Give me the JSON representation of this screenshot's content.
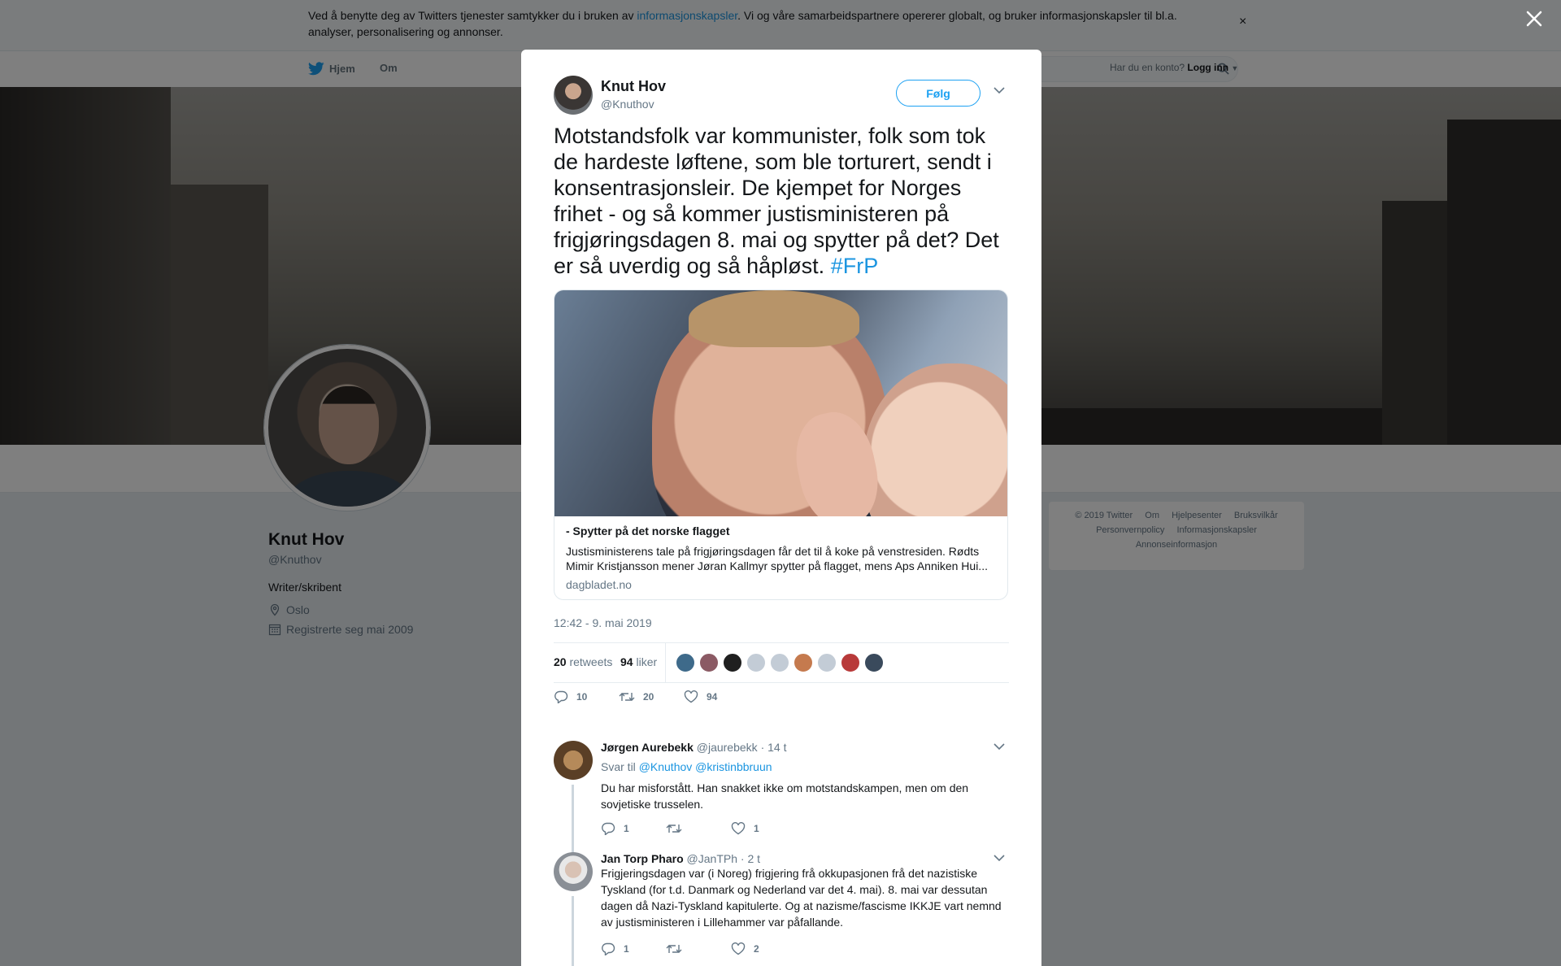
{
  "cookie": {
    "text_before": "Ved å benytte deg av Twitters tjenester samtykker du i bruken av ",
    "link": "informasjonskapsler",
    "text_after": ". Vi og våre samarbeidspartnere opererer globalt, og bruker informasjonskapsler til bl.a. analyser, personalisering og annonser.",
    "close": "×"
  },
  "nav": {
    "home": "Hjem",
    "about": "Om",
    "login_prompt": "Har du en konto?",
    "login": "Logg inn"
  },
  "profile": {
    "name": "Knut Hov",
    "handle": "@Knuthov",
    "bio": "Writer/skribent",
    "location": "Oslo",
    "joined": "Registrerte seg mai 2009"
  },
  "footer": {
    "row1": [
      "© 2019 Twitter",
      "Om",
      "Hjelpesenter",
      "Bruksvilkår"
    ],
    "row2": [
      "Personvernpolicy",
      "Informasjonskapsler"
    ],
    "row3": [
      "Annonseinformasjon"
    ]
  },
  "tweet": {
    "author_name": "Knut Hov",
    "author_handle": "@Knuthov",
    "follow": "Følg",
    "text": "Motstandsfolk var kommunister, folk som tok de hardeste løftene, som ble torturert, sendt i konsentrasjonsleir. De kjempet for Norges frihet - og så kommer justisministeren på frigjøringsdagen 8. mai og spytter på det? Det er så uverdig og så håpløst. ",
    "hashtag": "#FrP",
    "card": {
      "title": "- Spytter på det norske flagget",
      "description": "Justisministerens tale på frigjøringsdagen får det til å koke på venstresiden. Rødts Mimir Kristjansson mener Jøran Kallmyr spytter på flagget, mens Aps Anniken Hui...",
      "domain": "dagbladet.no"
    },
    "time": "12:42 - 9. mai 2019",
    "retweets_count": "20",
    "retweets_label": "retweets",
    "likes_count": "94",
    "likes_label": "liker",
    "reply_count": "10",
    "retweet_count": "20",
    "like_count": "94",
    "liker_colors": [
      "#3e6a8a",
      "#8b5a64",
      "#1f1f1f",
      "#c3ccd6",
      "#c3ccd6",
      "#c57a4e",
      "#c3ccd6",
      "#b83a3a",
      "#3a4a5c"
    ]
  },
  "replies": [
    {
      "name": "Jørgen Aurebekk",
      "handle": "@jaurebekk",
      "time": "· 14 t",
      "reply_to_label": "Svar til",
      "reply_to_1": "@Knuthov",
      "reply_to_2": "@kristinbbruun",
      "text": "Du har misforstått. Han snakket ikke om motstandskampen, men om den sovjetiske trusselen.",
      "replies": "1",
      "retweets": "",
      "likes": "1"
    },
    {
      "name": "Jan Torp Pharo",
      "handle": "@JanTPh",
      "time": "· 2 t",
      "text": "Frigjeringsdagen var (i Noreg) frigjering frå okkupasjonen frå det nazistiske Tyskland (for t.d. Danmark og Nederland var det 4. mai). 8. mai var dessutan dagen då Nazi-Tyskland kapitulerte. Og at nazisme/fascisme IKKJE vart nemnd av justisministeren i Lillehammer var påfallande.",
      "replies": "1",
      "retweets": "",
      "likes": "2"
    }
  ]
}
